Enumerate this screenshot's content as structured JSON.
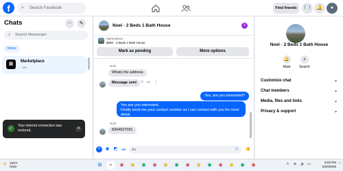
{
  "topbar": {
    "search_placeholder": "Search Facebook",
    "find_friends": "Find friends"
  },
  "left": {
    "title": "Chats",
    "search_placeholder": "Search Messenger",
    "inbox_tab": "Inbox",
    "item": {
      "title": "Marketplace",
      "sub": "· 1m"
    }
  },
  "toast": {
    "text": "Your internet connection was restored."
  },
  "chat": {
    "title": "Noel · 2 Beds 1 Bath House",
    "badge": "i",
    "card_label": "Marketplace",
    "card_desc": "$800 · 2 Beds 1 Bath House",
    "mark_pending": "Mark as pending",
    "more_options": "More options",
    "messages": [
      {
        "sender": "Noel",
        "text": "Whats the address"
      },
      {
        "text": "Message sent"
      },
      {
        "text": "Yes, are you interested?"
      },
      {
        "text": "Yes are you interested.\nKindly send me your contact number so i can contact with you for more detail."
      },
      {
        "sender": "Noel",
        "text": "8304637091"
      }
    ],
    "input_placeholder": "Aa"
  },
  "right": {
    "name": "Noel · 2 Beds 1 Bath House",
    "mute": "Mute",
    "search": "Search",
    "rows": [
      "Customize chat",
      "Chat members",
      "Media, files and links",
      "Privacy & support"
    ]
  },
  "taskbar": {
    "weather_temp": "100°F",
    "weather_desc": "Haze",
    "time": "8:03 PM",
    "date": "5/20/2025"
  },
  "colors": {
    "accent": "#0866ff",
    "badge": "#9b2ee8"
  }
}
